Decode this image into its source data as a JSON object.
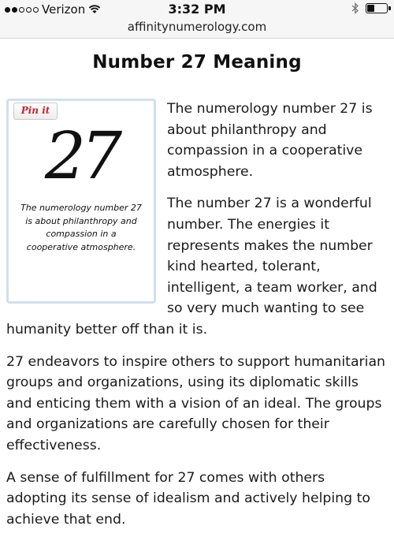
{
  "status_bar": {
    "carrier": "Verizon",
    "time": "3:32 PM",
    "signal_dots_filled": 2,
    "signal_dots_total": 5,
    "battery_level": 0.35
  },
  "browser": {
    "url": "affinitynumerology.com"
  },
  "page": {
    "title": "Number 27 Meaning",
    "pin_button": "Pin it",
    "image_number": "27",
    "image_caption": "The numerology number 27 is about philanthropy and compassion in a cooperative atmosphere.",
    "paragraphs": [
      "The numerology number 27 is about philanthropy and compassion in a cooperative atmosphere.",
      "The number 27 is a wonderful number. The energies it represents makes the number kind hearted, tolerant, intelligent, a team worker, and so very much wanting to see humanity better off than it is.",
      "27 endeavors to inspire others to support humanitarian groups and organizations, using its diplomatic skills and enticing them with a vision of an ideal. The groups and organizations are carefully chosen for their effectiveness.",
      "A sense of fulfillment for 27 comes with others adopting its sense of idealism and actively helping to achieve that end."
    ]
  },
  "colors": {
    "pin_red": "#c8232c",
    "card_border": "#cfe0f0"
  }
}
